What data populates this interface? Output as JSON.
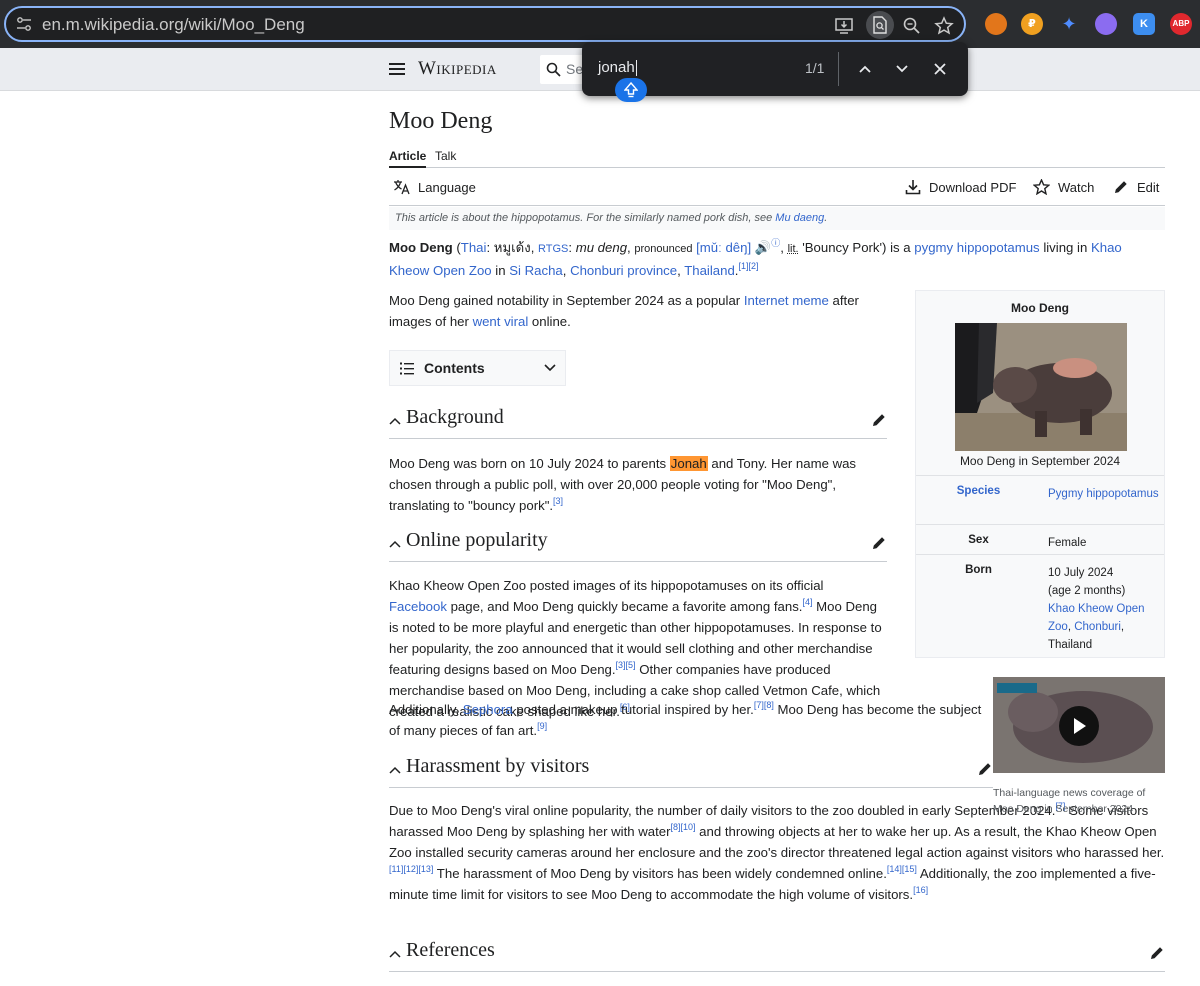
{
  "browser": {
    "url": "en.m.wikipedia.org/wiki/Moo_Deng",
    "extensions": [
      "metamask-icon",
      "coin-icon",
      "bolt-icon",
      "ghost-icon",
      "K",
      "ABP"
    ]
  },
  "find": {
    "query": "jonah",
    "count": "1/1"
  },
  "wiki": {
    "logo": "Wikipedia",
    "search_placeholder": "Se"
  },
  "article": {
    "title": "Moo Deng",
    "tabs": [
      {
        "label": "Article"
      },
      {
        "label": "Talk"
      }
    ],
    "toolbar": {
      "language": "Language",
      "download": "Download PDF",
      "watch": "Watch",
      "edit": "Edit"
    },
    "hatnote": {
      "text": "This article is about the hippopotamus. For the similarly named pork dish, see ",
      "link": "Mu daeng",
      "end": "."
    },
    "lead": {
      "name": "Moo Deng",
      "thai_link": "Thai",
      "thai_text": "หมูเด้ง",
      "rtgs": "RTGS",
      "romanized": "mu deng",
      "pronounced": "pronounced",
      "ipa": "[mǔː dêŋ]",
      "lit": "lit.",
      "meaning": "'Bouncy Pork'",
      "is_a": ") is a ",
      "species_link": "pygmy hippopotamus",
      "living_in": " living in ",
      "zoo_link": "Khao Kheow Open Zoo",
      "in": " in ",
      "place1": "Si Racha",
      "place2": "Chonburi province",
      "place3": "Thailand",
      "refs": "[1][2]"
    },
    "intro": {
      "text1": "Moo Deng gained notability in September 2024 as a popular ",
      "link1": "Internet meme",
      "text2": " after images of her ",
      "link2": "went viral",
      "text3": " online."
    },
    "contents_label": "Contents",
    "sections": {
      "background": "Background",
      "popularity": "Online popularity",
      "harassment": "Harassment by visitors",
      "references": "References"
    },
    "background_text": {
      "a": "Moo Deng was born on 10 July 2024 to parents ",
      "hl": "Jonah",
      "b": " and Tony. Her name was chosen through a public poll, with over 20,000 people voting for \"Moo Deng\", translating to \"bouncy pork\".",
      "ref": "[3]"
    },
    "popularity_text": {
      "a": "Khao Kheow Open Zoo posted images of its hippopotamuses on its official ",
      "link_fb": "Facebook",
      "b": " page, and Moo Deng quickly became a favorite among fans.",
      "r4": "[4]",
      "c": " Moo Deng is noted to be more playful and energetic than other hippopotamuses. In response to her popularity, the zoo announced that it would sell clothing and other merchandise featuring designs based on Moo Deng.",
      "r35": "[3][5]",
      "d": " Other companies have produced merchandise based on Moo Deng, including a cake shop called Vetmon Cafe, which created a realistic cake shaped like her.",
      "r6": "[6]",
      "e": "Additionally, ",
      "link_sephora": "Sephora",
      "f": " posted a makeup tutorial inspired by her.",
      "r78": "[7][8]",
      "g": " Moo Deng has become the subject of many pieces of fan art.",
      "r9": "[9]"
    },
    "harassment_text": {
      "a": "Due to Moo Deng's viral online popularity, the number of daily visitors to the zoo doubled in early September 2024.",
      "r7": "[7]",
      "b": " Some visitors harassed Moo Deng by splashing her with water",
      "r810": "[8][10]",
      "c": " and throwing objects at her to wake her up. As a result, the Khao Kheow Open Zoo installed security cameras around her enclosure and the zoo's director threatened legal action against visitors who harassed her.",
      "r1113": "[11][12][13]",
      "d": " The harassment of Moo Deng by visitors has been widely condemned online.",
      "r1415": "[14][15]",
      "e": " Additionally, the zoo implemented a five-minute time limit for visitors to see Moo Deng to accommodate the high volume of visitors.",
      "r16": "[16]"
    },
    "infobox": {
      "title": "Moo Deng",
      "caption": "Moo Deng in September 2024",
      "species_label": "Species",
      "species_value": "Pygmy hippopotamus",
      "sex_label": "Sex",
      "sex_value": "Female",
      "born_label": "Born",
      "born_date": "10 July 2024",
      "born_age": "(age 2 months)",
      "born_place_link": "Khao Kheow Open Zoo",
      "born_comma": ", ",
      "born_city_link": "Chonburi",
      "born_country": "Thailand"
    },
    "video_caption": "Thai-language news coverage of Moo Deng in September 2024"
  },
  "colors": {
    "link": "#3366cc",
    "highlight": "#ff9632",
    "chrome_bg": "#2b2d30",
    "focus_ring": "#8ab4f8"
  }
}
